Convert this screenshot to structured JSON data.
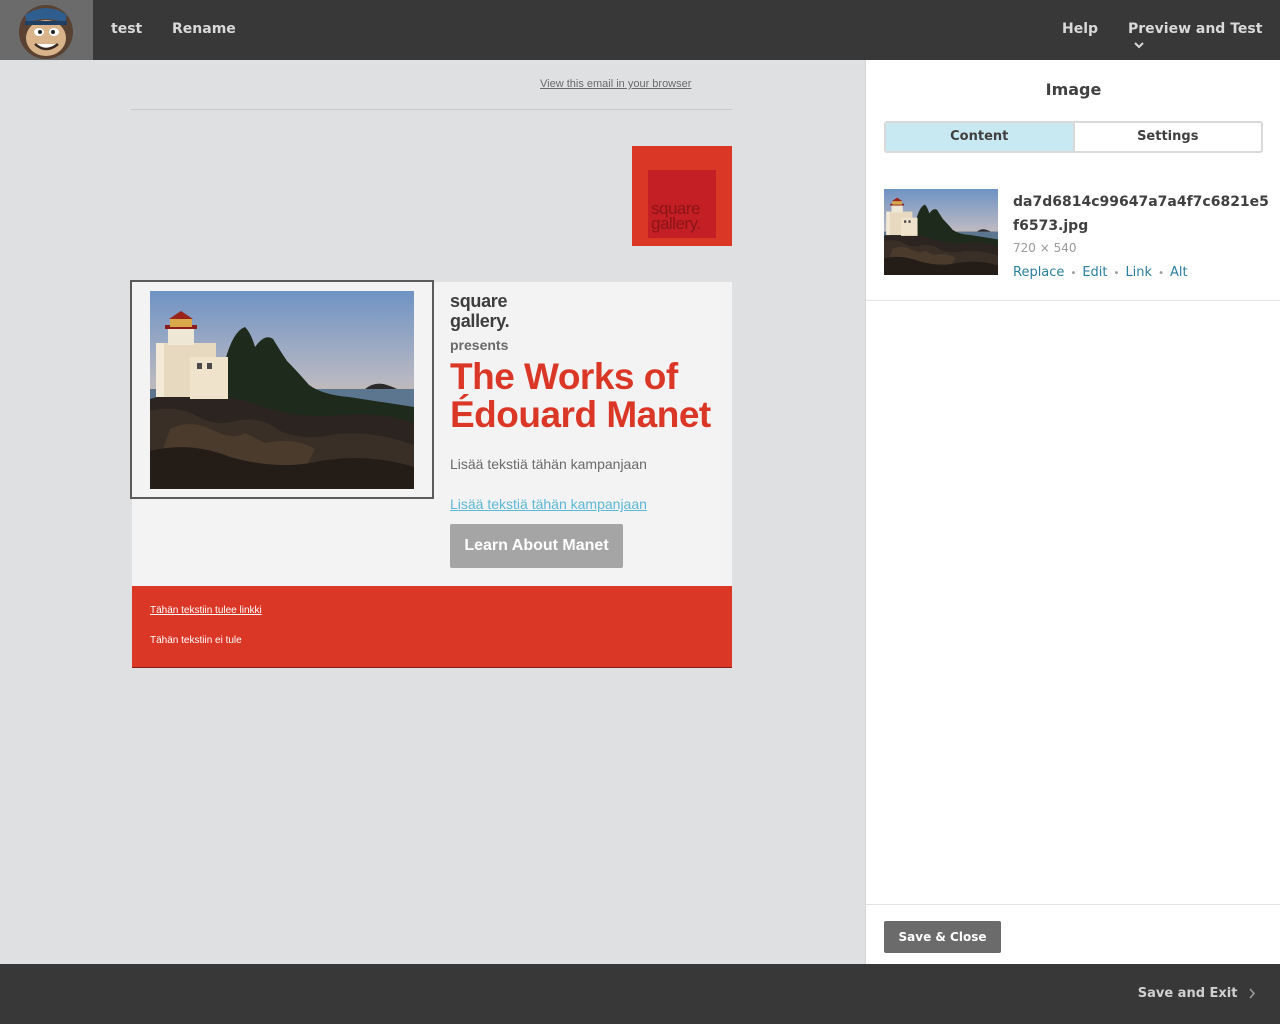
{
  "topbar": {
    "logo_name": "mailchimp-freddie-logo",
    "campaign_name": "test",
    "rename_label": "Rename",
    "help_label": "Help",
    "preview_label": "Preview and Test",
    "preview_icon": "chevron-down-icon"
  },
  "email": {
    "view_in_browser": "View this email in your browser",
    "brand_logo_text": "square\ngallery.",
    "brand_name": "square\ngallery.",
    "presents": "presents",
    "headline": "The Works of Édouard Manet",
    "body_text": "Lisää tekstiä tähän kampanjaan",
    "body_link": "Lisää tekstiä tähän kampanjaan",
    "cta_label": "Learn About Manet",
    "footer_link": "Tähän tekstiin tulee linkki",
    "footer_text": "Tähän tekstiin ei tule",
    "colors": {
      "accent": "#da3727",
      "button": "#a5a5a5",
      "link": "#5bb8d6"
    }
  },
  "panel": {
    "title": "Image",
    "tabs": [
      {
        "label": "Content",
        "active": true
      },
      {
        "label": "Settings",
        "active": false
      }
    ],
    "file": {
      "name": "da7d6814c99647a7a4f7c6821e5f6573.jpg",
      "dimensions": "720 × 540",
      "actions": [
        "Replace",
        "Edit",
        "Link",
        "Alt"
      ]
    },
    "save_close_label": "Save & Close"
  },
  "bottombar": {
    "save_exit_label": "Save and Exit",
    "save_exit_icon": "chevron-right-icon"
  }
}
